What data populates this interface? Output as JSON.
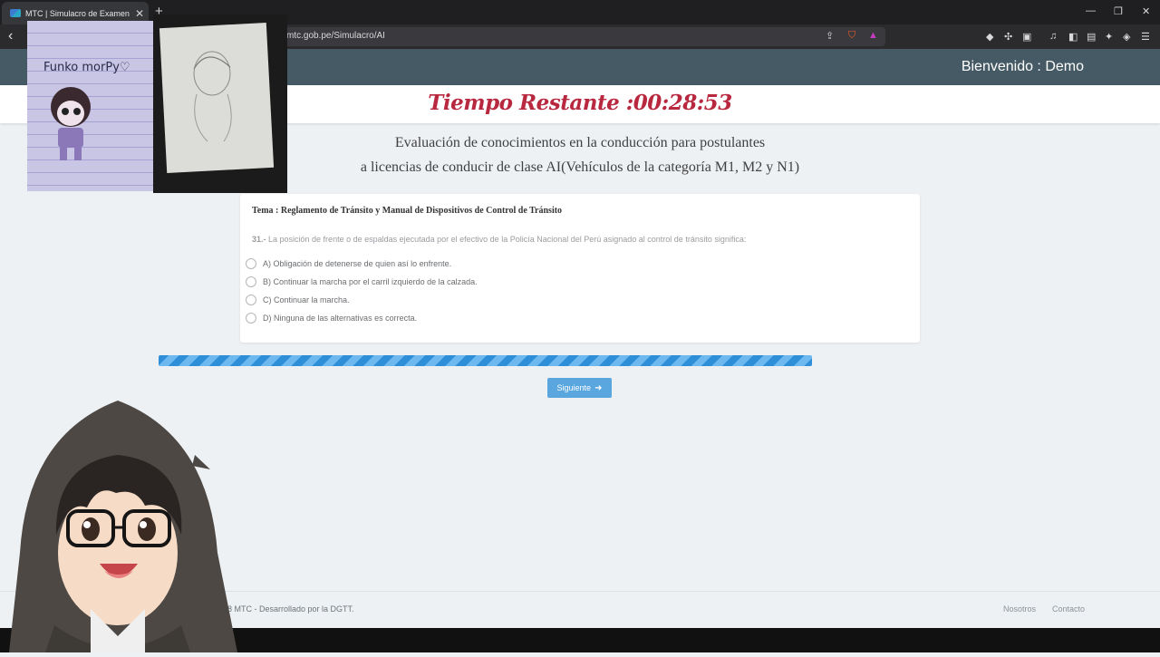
{
  "browser": {
    "tab_title": "MTC | Simulacro de Examen de C",
    "tab_close": "✕",
    "new_tab": "+",
    "url": "mtc.gob.pe/Simulacro/AI",
    "window_controls": [
      "—",
      "❐",
      "✕"
    ],
    "icons": [
      "back-icon",
      "share-icon",
      "brave-shield-icon",
      "rewards-icon",
      "extension-icon",
      "puzzle-icon",
      "media-icon",
      "sidebar-icon",
      "wallet-icon",
      "leo-icon",
      "vpn-icon",
      "menu-icon"
    ]
  },
  "header": {
    "welcome": "Bienvenido : Demo",
    "timer": "Tiempo Restante :00:28:53"
  },
  "main": {
    "heading_line1": "Evaluación de conocimientos en la conducción para postulantes",
    "heading_line2": "a licencias de conducir de clase AI(Vehículos de la categoría M1, M2 y N1)",
    "topic": "Tema : Reglamento de Tránsito y Manual de Dispositivos de Control de Tránsito",
    "question_number": "31.-",
    "question_text": " La posición de frente o de espaldas ejecutada por el efectivo de la Policía Nacional del Perú asignado al control de tránsito significa:",
    "options": [
      "A) Obligación de detenerse de quien así lo enfrente.",
      "B) Continuar la marcha por el carril izquierdo de la calzada.",
      "C) Continuar la marcha.",
      "D) Ninguna de las alternativas es correcta."
    ],
    "progress": 1.0,
    "next_label": "Siguiente"
  },
  "footer": {
    "copyright": "7-2018 MTC - Desarrollado por la DGTT.",
    "links": [
      "Nosotros",
      "Contacto"
    ]
  },
  "overlay": {
    "drawing_text": "Funko morPy♡"
  },
  "colors": {
    "navbar": "#465a66",
    "timer": "#b8283f",
    "progress": "#2e8fd8",
    "button": "#5aa7e0"
  }
}
